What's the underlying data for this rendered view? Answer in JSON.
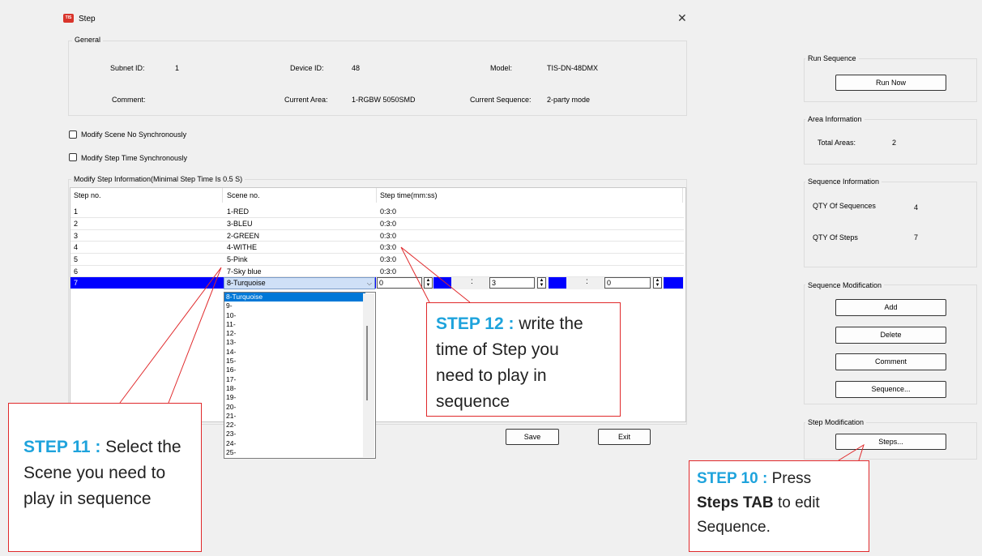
{
  "window": {
    "title": "Step",
    "icon": "TIS",
    "close": "✕"
  },
  "general": {
    "legend": "General",
    "subnet_label": "Subnet ID:",
    "subnet_value": "1",
    "device_label": "Device ID:",
    "device_value": "48",
    "model_label": "Model:",
    "model_value": "TIS-DN-48DMX",
    "comment_label": "Comment:",
    "area_label": "Current Area:",
    "area_value": "1-RGBW 5050SMD",
    "sequence_label": "Current Sequence:",
    "sequence_value": "2-party mode"
  },
  "options": {
    "sync_scene": "Modify Scene No Synchronously",
    "sync_time": "Modify Step Time Synchronously"
  },
  "steps": {
    "legend": "Modify Step Information(Minimal Step Time Is 0.5 S)",
    "headers": [
      "Step no.",
      "Scene no.",
      "Step time(mm:ss)"
    ],
    "rows": [
      [
        "1",
        "1-RED",
        "0:3:0"
      ],
      [
        "2",
        "3-BLEU",
        "0:3:0"
      ],
      [
        "3",
        "2-GREEN",
        "0:3:0"
      ],
      [
        "4",
        "4-WITHE",
        "0:3:0"
      ],
      [
        "5",
        "5-Pink",
        "0:3:0"
      ],
      [
        "6",
        "7-Sky blue",
        "0:3:0"
      ]
    ],
    "edit_row": {
      "step": "7",
      "scene": "8-Turquoise",
      "minutes": "0",
      "seconds": "3",
      "fraction": "0"
    },
    "dropdown": [
      "8-Turquoise",
      "9-",
      "10-",
      "11-",
      "12-",
      "13-",
      "14-",
      "15-",
      "16-",
      "17-",
      "18-",
      "19-",
      "20-",
      "21-",
      "22-",
      "23-",
      "24-",
      "25-"
    ]
  },
  "buttons": {
    "save": "Save",
    "exit": "Exit"
  },
  "side": {
    "run": {
      "legend": "Run Sequence",
      "button": "Run Now"
    },
    "area": {
      "legend": "Area Information",
      "total_label": "Total Areas:",
      "total_value": "2"
    },
    "seqinfo": {
      "legend": "Sequence Information",
      "qty_seq_label": "QTY Of Sequences",
      "qty_seq_value": "4",
      "qty_steps_label": "QTY Of Steps",
      "qty_steps_value": "7"
    },
    "seqmod": {
      "legend": "Sequence Modification",
      "add": "Add",
      "delete": "Delete",
      "comment": "Comment",
      "sequence": "Sequence..."
    },
    "stepmod": {
      "legend": "Step Modification",
      "steps": "Steps..."
    }
  },
  "callouts": {
    "step11": {
      "kw": "STEP 11  :",
      "text1": " Select the",
      "text2": "Scene you need to",
      "text3": "play in sequence"
    },
    "step12": {
      "kw": "STEP 12  :",
      "text1": " write the",
      "text2": "time of Step you",
      "text3": "need to play in",
      "text4": "sequence"
    },
    "step10": {
      "kw": "STEP 10 :",
      "text1": " Press",
      "bold": "Steps TAB",
      "text2": " to edit",
      "text3": "Sequence."
    }
  },
  "colors": {
    "callout_border": "#e0292b",
    "step_keyword": "#1ea3dc",
    "selection": "#0000ff"
  }
}
